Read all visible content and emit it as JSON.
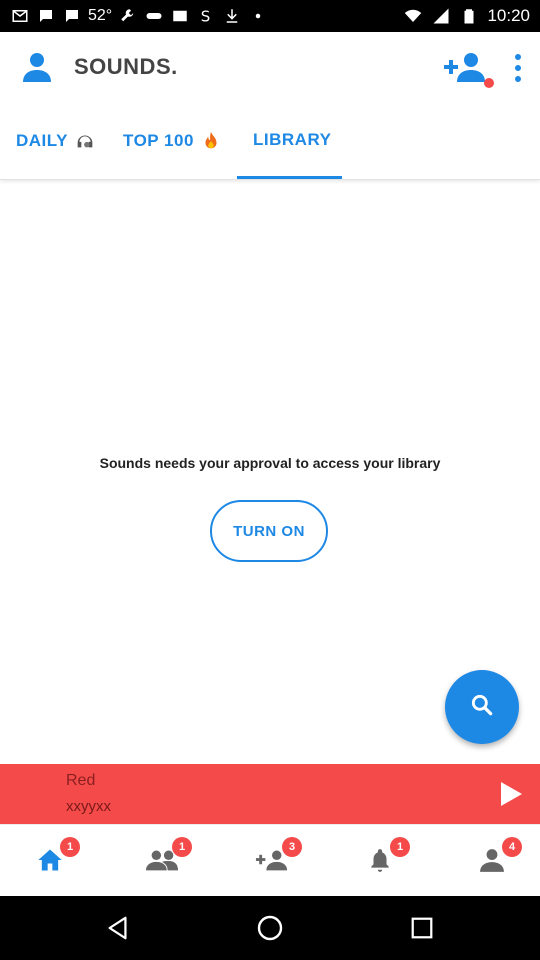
{
  "status_bar": {
    "temperature": "52°",
    "time": "10:20"
  },
  "header": {
    "title": "SOUNDS.",
    "avatar_icon": "person-icon",
    "add_friend_icon": "person-add-icon",
    "more_icon": "more-vert-icon"
  },
  "tabs": [
    {
      "label": "DAILY",
      "icon": "headphones-icon"
    },
    {
      "label": "TOP 100",
      "icon": "fire-icon"
    },
    {
      "label": "LIBRARY",
      "active": true
    }
  ],
  "main": {
    "approval_text": "Sounds needs your approval to access your library",
    "turn_on_label": "TURN ON"
  },
  "player": {
    "title": "Red",
    "artist": "xxyyxx"
  },
  "bottom_nav": [
    {
      "icon": "home-icon",
      "badge": "1"
    },
    {
      "icon": "people-icon",
      "badge": "1"
    },
    {
      "icon": "person-add-icon",
      "badge": "3"
    },
    {
      "icon": "bell-icon",
      "badge": "1"
    },
    {
      "icon": "person-icon",
      "badge": "4"
    }
  ],
  "colors": {
    "accent": "#1e88e5",
    "player_bg": "#f44a4a",
    "badge": "#f44a4a"
  }
}
